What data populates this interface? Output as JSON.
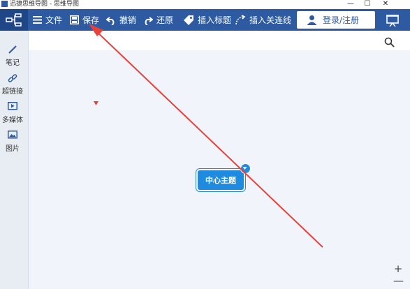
{
  "window": {
    "title": "迅捷思维导图 - 思维导图",
    "minimize": "—",
    "maximize": "☐",
    "close": "✕"
  },
  "toolbar": {
    "file_label": "文件",
    "save_label": "保存",
    "undo_label": "撤销",
    "redo_label": "还原",
    "insert_title_label": "插入标题",
    "insert_link_label": "插入关连线",
    "login_label": "登录/注册"
  },
  "sidebar": {
    "items": [
      {
        "label": "笔记",
        "icon": "pen-icon"
      },
      {
        "label": "超链接",
        "icon": "link-icon"
      },
      {
        "label": "多媒体",
        "icon": "video-icon"
      },
      {
        "label": "图片",
        "icon": "image-icon"
      }
    ]
  },
  "canvas": {
    "central_topic": "中心主题",
    "zoom_in": "+",
    "zoom_out": "—"
  },
  "colors": {
    "toolbar": "#2d5aa0",
    "node": "#1f8be0",
    "annotation_arrow": "#e8413a"
  }
}
